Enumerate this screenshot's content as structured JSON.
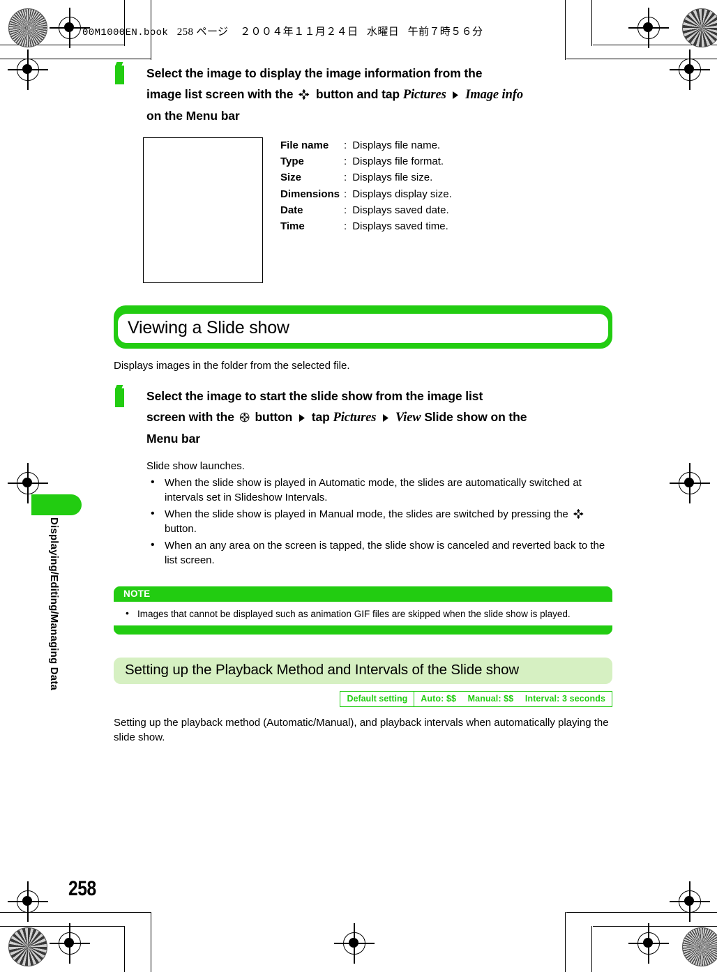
{
  "print_header": {
    "filename": "00M1000EN.book",
    "page_label": "258 ページ",
    "date": "２００４年１１月２４日",
    "weekday": "水曜日",
    "time": "午前７時５６分"
  },
  "side_tab": {
    "label": "Displaying/Editing/Managing Data"
  },
  "page_number": "258",
  "colors": {
    "brand_green": "#22cc11",
    "light_green": "#d6f0c2",
    "text": "#000000"
  },
  "step_one": {
    "number": "1",
    "line1": "Select the image to display the image information from the",
    "line2_a": "image list screen with the",
    "line2_b": "button and tap",
    "line2_italic1": "Pictures",
    "line2_italic2": "Image info",
    "line3": "on the Menu bar"
  },
  "image_info": {
    "rows": [
      {
        "key": "File name",
        "sep": ":",
        "value": "Displays file name."
      },
      {
        "key": "Type",
        "sep": ":",
        "value": "Displays file format."
      },
      {
        "key": "Size",
        "sep": ":",
        "value": "Displays file size."
      },
      {
        "key": "Dimensions",
        "sep": ":",
        "value": "Displays display size."
      },
      {
        "key": "Date",
        "sep": ":",
        "value": "Displays saved date."
      },
      {
        "key": "Time",
        "sep": ":",
        "value": "Displays saved time."
      }
    ]
  },
  "slideshow_section": {
    "title": "Viewing a Slide show",
    "description": "Displays images in the folder from the selected file.",
    "step": {
      "number": "1",
      "line1": "Select the image to start the slide show from the image list",
      "line2_a": "screen with the",
      "line2_b": "button",
      "line2_c": "tap",
      "line2_italic1": "Pictures",
      "line2_italic2": "View",
      "line2_d": "Slide show on the",
      "line3": "Menu bar"
    },
    "result_text": "Slide show launches.",
    "bullets": [
      {
        "a": "When the slide show is played in",
        "i1": "Automatic",
        "b": "mode, the slides are automatically switched at intervals set in",
        "i2": "Slideshow Intervals",
        "c": "."
      },
      {
        "a": "When the slide show is played in",
        "i1": "Manual",
        "b": "mode, the slides are switched by pressing the",
        "c": "button."
      },
      {
        "a": "When an any area on the screen is tapped, the slide show is canceled and reverted back to the list screen."
      }
    ]
  },
  "note": {
    "title": "NOTE",
    "bullets": [
      "Images that cannot be displayed such as animation GIF files are skipped when the slide show is played."
    ]
  },
  "playback_section": {
    "title": "Setting up the Playback Method and Intervals of the Slide show",
    "default_setting": {
      "label": "Default setting",
      "values": [
        "Auto: $$",
        "Manual: $$",
        "Interval: 3 seconds"
      ]
    },
    "description": "Setting up the playback method (Automatic/Manual), and playback intervals when automatically playing the slide show."
  }
}
